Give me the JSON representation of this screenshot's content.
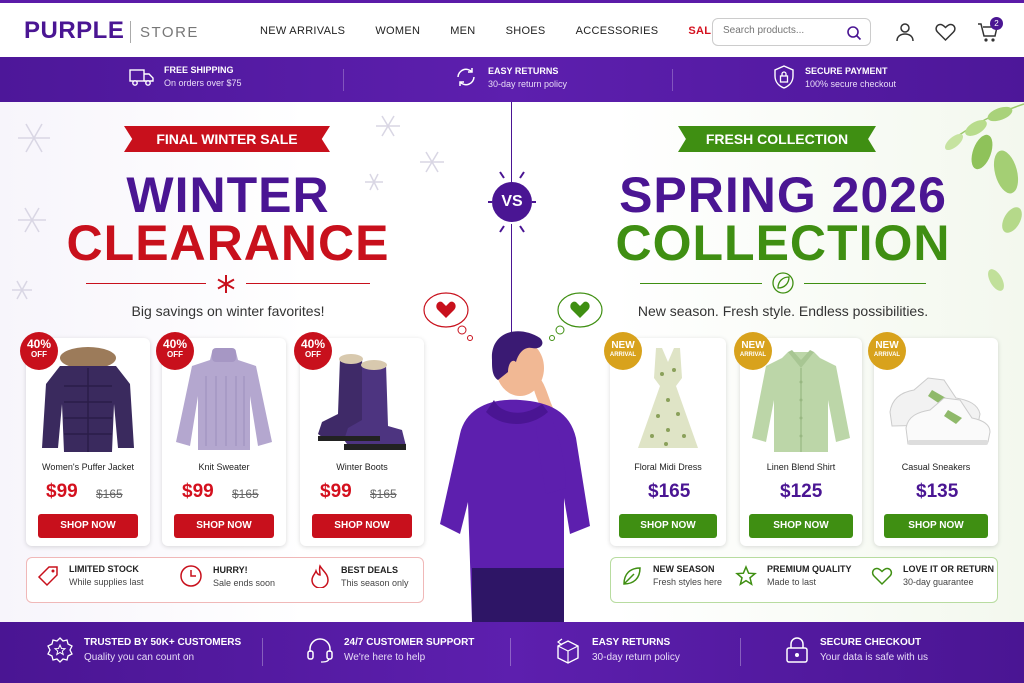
{
  "brand": {
    "name": "PURPLE",
    "sub": "STORE"
  },
  "nav": [
    {
      "label": "NEW ARRIVALS"
    },
    {
      "label": "WOMEN"
    },
    {
      "label": "MEN"
    },
    {
      "label": "SHOES"
    },
    {
      "label": "ACCESSORIES"
    },
    {
      "label": "SALE"
    }
  ],
  "search": {
    "placeholder": "Search products..."
  },
  "cart": {
    "count": "2"
  },
  "infobar": [
    {
      "title": "FREE SHIPPING",
      "sub": "On orders over $75",
      "icon": "truck-icon"
    },
    {
      "title": "EASY RETURNS",
      "sub": "30-day return policy",
      "icon": "return-icon"
    },
    {
      "title": "SECURE PAYMENT",
      "sub": "100% secure checkout",
      "icon": "shield-lock-icon"
    }
  ],
  "winter": {
    "ribbon": "FINAL WINTER SALE",
    "line1": "WINTER",
    "line2": "CLEARANCE",
    "tagline": "Big savings on winter favorites!",
    "products": [
      {
        "name": "Women's Puffer Jacket",
        "price": "$99",
        "old": "$165",
        "badge": "40%",
        "badge_sub": "OFF",
        "cta": "SHOP NOW"
      },
      {
        "name": "Knit Sweater",
        "price": "$99",
        "old": "$165",
        "badge": "40%",
        "badge_sub": "OFF",
        "cta": "SHOP NOW"
      },
      {
        "name": "Winter Boots",
        "price": "$99",
        "old": "$165",
        "badge": "40%",
        "badge_sub": "OFF",
        "cta": "SHOP NOW"
      }
    ],
    "features": [
      {
        "title": "LIMITED STOCK",
        "sub": "While supplies last"
      },
      {
        "title": "HURRY!",
        "sub": "Sale ends soon"
      },
      {
        "title": "BEST DEALS",
        "sub": "This season only"
      }
    ]
  },
  "vs": "VS",
  "spring": {
    "ribbon": "FRESH COLLECTION",
    "line1": "SPRING 2026",
    "line2": "COLLECTION",
    "tagline": "New season. Fresh style. Endless possibilities.",
    "products": [
      {
        "name": "Floral Midi Dress",
        "price": "$165",
        "badge": "NEW",
        "badge_sub": "ARRIVAL",
        "cta": "SHOP NOW"
      },
      {
        "name": "Linen Blend Shirt",
        "price": "$125",
        "badge": "NEW",
        "badge_sub": "ARRIVAL",
        "cta": "SHOP NOW"
      },
      {
        "name": "Casual Sneakers",
        "price": "$135",
        "badge": "NEW",
        "badge_sub": "ARRIVAL",
        "cta": "SHOP NOW"
      }
    ],
    "features": [
      {
        "title": "NEW SEASON",
        "sub": "Fresh styles here"
      },
      {
        "title": "PREMIUM QUALITY",
        "sub": "Made to last"
      },
      {
        "title": "LOVE IT OR RETURN",
        "sub": "30-day guarantee"
      }
    ]
  },
  "footer": [
    {
      "title": "TRUSTED BY 50K+ CUSTOMERS",
      "sub": "Quality you can count on"
    },
    {
      "title": "24/7 CUSTOMER SUPPORT",
      "sub": "We're here to help"
    },
    {
      "title": "EASY RETURNS",
      "sub": "30-day return policy"
    },
    {
      "title": "SECURE CHECKOUT",
      "sub": "Your data is safe with us"
    }
  ],
  "colors": {
    "purple": "#4a1593",
    "red": "#c8101c",
    "green": "#3f8f12",
    "gold": "#d8a21c"
  }
}
